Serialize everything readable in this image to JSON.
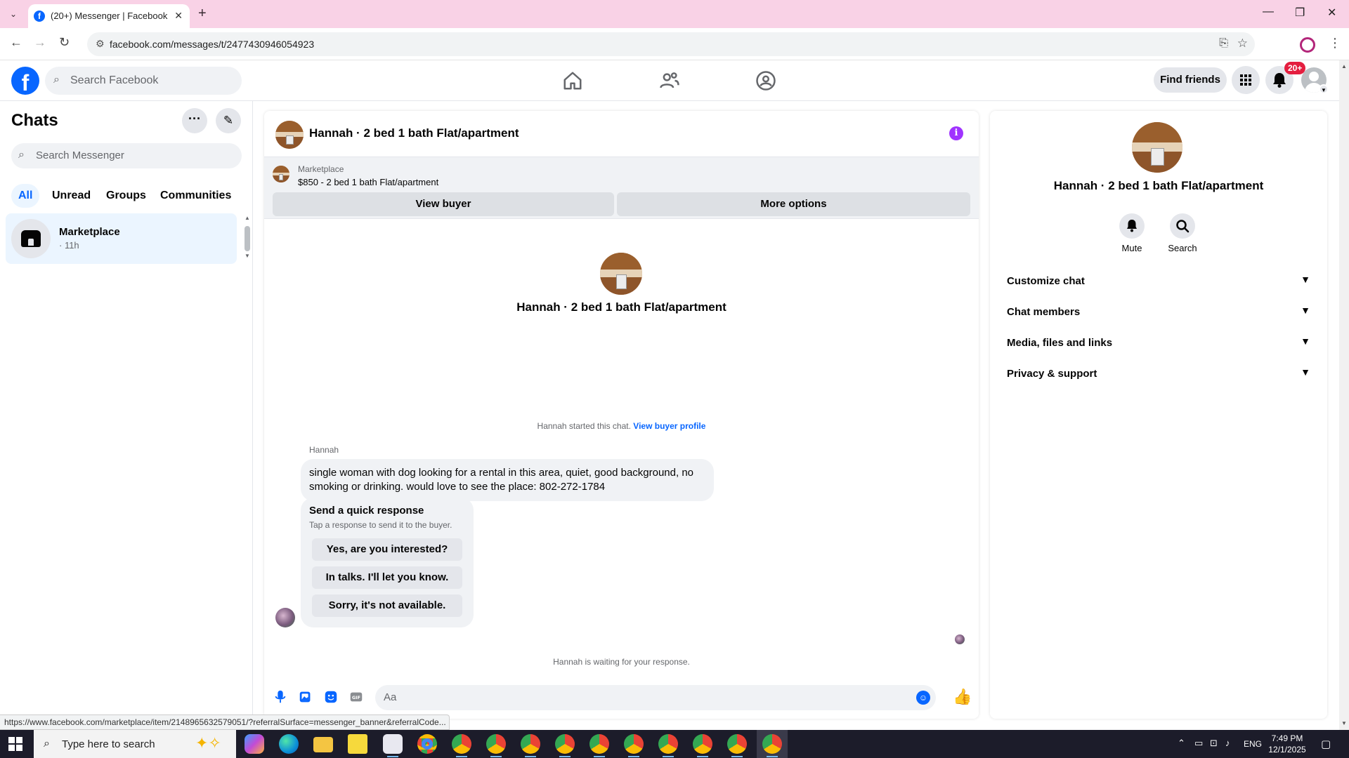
{
  "browser": {
    "tab_title": "(20+) Messenger | Facebook",
    "url": "facebook.com/messages/t/2477430946054923",
    "status_url": "https://www.facebook.com/marketplace/item/2148965632579051/?referralSurface=messenger_banner&referralCode..."
  },
  "fb_nav": {
    "search_placeholder": "Search Facebook",
    "find_friends_label": "Find friends",
    "notification_badge": "20+"
  },
  "chats_panel": {
    "title": "Chats",
    "search_placeholder": "Search Messenger",
    "filters": [
      "All",
      "Unread",
      "Groups",
      "Communities"
    ],
    "active_filter": "All",
    "items": [
      {
        "name": "Marketplace",
        "time": "· 11h"
      }
    ]
  },
  "conversation": {
    "title": "Hannah · 2 bed 1 bath Flat/apartment",
    "banner": {
      "label": "Marketplace",
      "listing": "$850 - 2 bed 1 bath Flat/apartment",
      "view_buyer_label": "View buyer",
      "more_options_label": "More options"
    },
    "hero_name": "Hannah · 2 bed 1 bath Flat/apartment",
    "started_text": "Hannah started this chat.",
    "started_link": "View buyer profile",
    "sender": "Hannah",
    "message": "single woman with dog looking for a rental in this area, quiet, good background, no smoking or drinking. would love to see the place: 802-272-1784",
    "quick_response": {
      "title": "Send a quick response",
      "subtitle": "Tap a response to send it to the buyer.",
      "options": [
        "Yes, are you interested?",
        "In talks. I'll let you know.",
        "Sorry, it's not available."
      ]
    },
    "waiting_text": "Hannah is waiting for your response.",
    "composer_placeholder": "Aa"
  },
  "details_panel": {
    "name": "Hannah · 2 bed 1 bath Flat/apartment",
    "actions": [
      "Mute",
      "Search"
    ],
    "sections": [
      "Customize chat",
      "Chat members",
      "Media, files and links",
      "Privacy & support"
    ]
  },
  "taskbar": {
    "search_placeholder": "Type here to search",
    "language": "ENG",
    "time": "7:49 PM",
    "date": "12/1/2025"
  },
  "colors": {
    "fb_blue": "#0866ff",
    "chrome_tab_strip": "#f9d2e6",
    "info_purple": "#a033ff",
    "badge_red": "#e41e3f"
  }
}
